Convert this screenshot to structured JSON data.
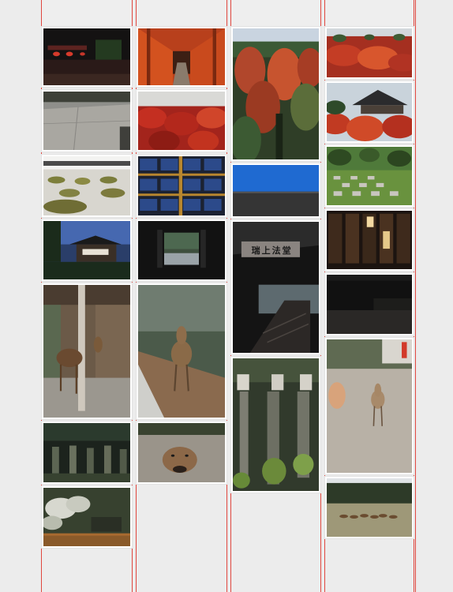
{
  "gallery": {
    "columns": [
      {
        "name": "column-1",
        "photos": [
          {
            "name": "night-temple-lanterns-photo"
          },
          {
            "name": "stone-courtyard-photo"
          },
          {
            "name": "moss-garden-photo"
          },
          {
            "name": "temple-pavilion-dusk-photo"
          },
          {
            "name": "deer-by-pillar-photo"
          },
          {
            "name": "stone-lanterns-forest-photo"
          },
          {
            "name": "white-blossom-garden-photo"
          }
        ]
      },
      {
        "name": "column-2",
        "photos": [
          {
            "name": "torii-gate-tunnel-photo"
          },
          {
            "name": "red-maple-roof-photo"
          },
          {
            "name": "painted-ceiling-panels-photo"
          },
          {
            "name": "dark-window-frame-photo"
          },
          {
            "name": "deer-on-path-photo"
          },
          {
            "name": "deer-closeup-photo"
          }
        ]
      },
      {
        "name": "column-3",
        "photos": [
          {
            "name": "autumn-valley-photo"
          },
          {
            "name": "blue-sky-rooftop-photo"
          },
          {
            "name": "temple-gate-sign-photo",
            "sign_text": "瑞上法堂"
          },
          {
            "name": "stone-lanterns-moss-photo"
          }
        ]
      },
      {
        "name": "column-4",
        "photos": [
          {
            "name": "red-foliage-hillside-photo"
          },
          {
            "name": "temple-roof-maple-photo"
          },
          {
            "name": "checkered-moss-garden-photo"
          },
          {
            "name": "calligraphy-lanterns-photo"
          },
          {
            "name": "dark-corridor-photo"
          },
          {
            "name": "deer-gravel-street-photo"
          },
          {
            "name": "deer-herd-field-photo"
          }
        ]
      }
    ]
  }
}
